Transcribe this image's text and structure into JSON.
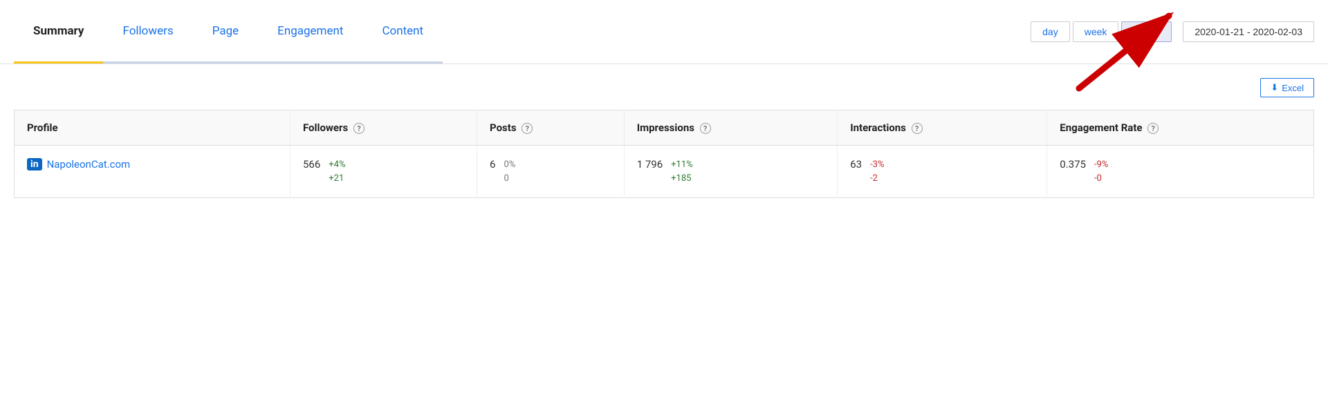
{
  "nav": {
    "tabs": [
      {
        "label": "Summary",
        "active": true
      },
      {
        "label": "Followers",
        "active": false
      },
      {
        "label": "Page",
        "active": false
      },
      {
        "label": "Engagement",
        "active": false
      },
      {
        "label": "Content",
        "active": false
      }
    ]
  },
  "timePeriods": {
    "options": [
      "day",
      "week",
      "month"
    ],
    "active": "month"
  },
  "dateRange": {
    "label": "2020-01-21 - 2020-02-03"
  },
  "excel": {
    "label": "Excel",
    "icon": "⬇"
  },
  "table": {
    "headers": [
      {
        "label": "Profile",
        "hasHelp": false
      },
      {
        "label": "Followers",
        "hasHelp": true
      },
      {
        "label": "Posts",
        "hasHelp": true
      },
      {
        "label": "Impressions",
        "hasHelp": true
      },
      {
        "label": "Interactions",
        "hasHelp": true
      },
      {
        "label": "Engagement Rate",
        "hasHelp": true
      }
    ],
    "rows": [
      {
        "profile": {
          "platform": "in",
          "name": "NapoleonCat.com",
          "link": "#"
        },
        "followers": {
          "value": "566",
          "change1": "+4%",
          "change1_type": "pos",
          "change2": "+21",
          "change2_type": "pos"
        },
        "posts": {
          "value": "6",
          "change1": "0%",
          "change1_type": "neutral",
          "change2": "0",
          "change2_type": "neutral"
        },
        "impressions": {
          "value": "1 796",
          "change1": "+11%",
          "change1_type": "pos",
          "change2": "+185",
          "change2_type": "pos"
        },
        "interactions": {
          "value": "63",
          "change1": "-3%",
          "change1_type": "neg",
          "change2": "-2",
          "change2_type": "neg"
        },
        "engagementRate": {
          "value": "0.375",
          "change1": "-9%",
          "change1_type": "neg",
          "change2": "-0",
          "change2_type": "neg"
        }
      }
    ]
  }
}
